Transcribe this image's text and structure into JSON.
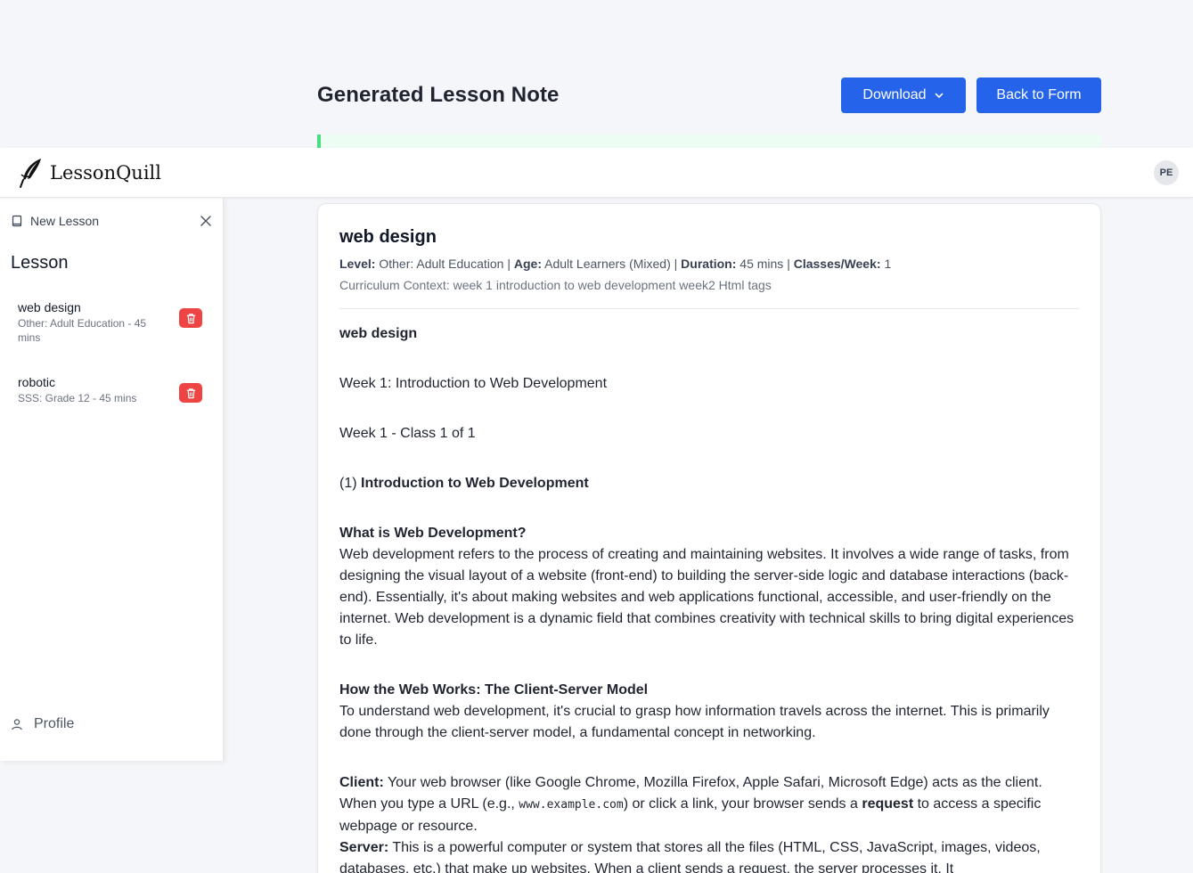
{
  "page": {
    "title": "Generated Lesson Note",
    "download_label": "Download",
    "back_label": "Back to Form",
    "progress_percent": 0.5
  },
  "nav": {
    "brand": "LessonQuill",
    "avatar_initials": "PE"
  },
  "sidebar": {
    "new_lesson_label": "New Lesson",
    "heading": "Lesson",
    "items": [
      {
        "title": "web design",
        "subtitle": "Other: Adult Education - 45 mins"
      },
      {
        "title": "robotic",
        "subtitle": "SSS: Grade 12 - 45 mins"
      }
    ],
    "profile_label": "Profile"
  },
  "lesson": {
    "title": "web design",
    "meta": {
      "level_label": "Level:",
      "level": "Other: Adult Education",
      "age_label": "Age:",
      "age": "Adult Learners (Mixed)",
      "duration_label": "Duration:",
      "duration": "45 mins",
      "classes_label": "Classes/Week:",
      "classes": "1",
      "sep": " | "
    },
    "context": "Curriculum Context: week 1 introduction to web development week2 Html tags",
    "note": {
      "heading": "web design",
      "week_line": "Week 1: Introduction to Web Development",
      "class_line": "Week 1 - Class 1 of 1",
      "section_num": "(1) ",
      "section_title": "Introduction to Web Development",
      "what_heading": "What is Web Development?",
      "what_body": "Web development refers to the process of creating and maintaining websites. It involves a wide range of tasks, from designing the visual layout of a website (front-end) to building the server-side logic and database interactions (back-end). Essentially, it's about making websites and web applications functional, accessible, and user-friendly on the internet. Web development is a dynamic field that combines creativity with technical skills to bring digital experiences to life.",
      "how_heading": "How the Web Works: The Client-Server Model",
      "how_body": "To understand web development, it's crucial to grasp how information travels across the internet. This is primarily done through the client-server model, a fundamental concept in networking.",
      "client_label": "Client:",
      "client_body_1": " Your web browser (like Google Chrome, Mozilla Firefox, Apple Safari, Microsoft Edge) acts as the client. When you type a URL (e.g., ",
      "client_code": "www.example.com",
      "client_body_2": ") or click a link, your browser sends a ",
      "client_bold": "request",
      "client_body_3": " to access a specific webpage or resource.",
      "server_label": "Server:",
      "server_body": " This is a powerful computer or system that stores all the files (HTML, CSS, JavaScript, images, videos, databases, etc.) that make up websites. When a client sends a request, the server processes it. It"
    }
  },
  "colors": {
    "primary": "#2563eb",
    "danger": "#ef4444",
    "progress": "#4ade80"
  }
}
